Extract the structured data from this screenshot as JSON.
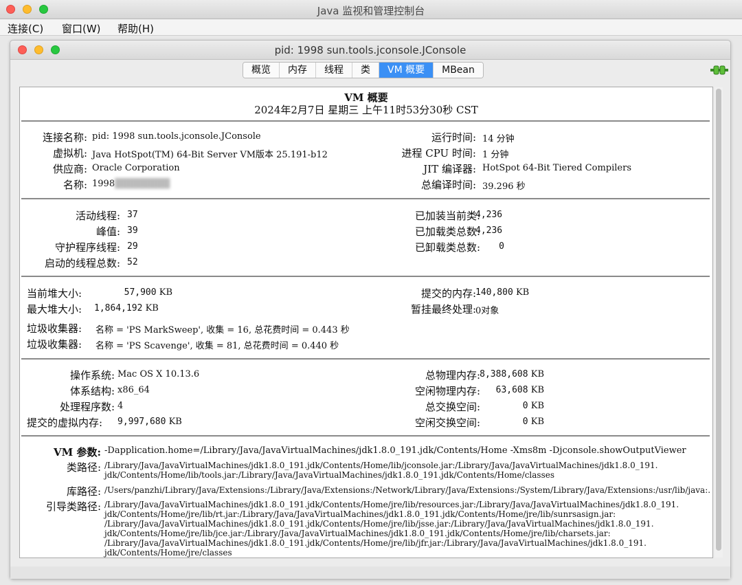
{
  "window": {
    "title": "Java 监视和管理控制台",
    "menus": [
      "连接(C)",
      "窗口(W)",
      "帮助(H)"
    ]
  },
  "inner_window": {
    "title": "pid: 1998 sun.tools.jconsole.JConsole"
  },
  "tabs": [
    "概览",
    "内存",
    "线程",
    "类",
    "VM 概要",
    "MBean"
  ],
  "active_tab": "VM 概要",
  "summary": {
    "title": "VM 概要",
    "datetime": "2024年2月7日 星期三 上午11时53分30秒 CST"
  },
  "vm_info": {
    "conn_label": "连接名称:",
    "conn_value": "pid: 1998 sun.tools.jconsole.JConsole",
    "vm_label": "虚拟机:",
    "vm_value": "Java HotSpot(TM) 64-Bit Server VM版本 25.191-b12",
    "vendor_label": "供应商:",
    "vendor_value": "Oracle Corporation",
    "name_label": "名称:",
    "name_value": "1998",
    "uptime_label": "运行时间:",
    "uptime_value": "14 分钟",
    "cpu_label": "进程 CPU 时间:",
    "cpu_value": "1 分钟",
    "jit_label": "JIT 编译器:",
    "jit_value": "HotSpot 64-Bit Tiered Compilers",
    "compile_label": "总编译时间:",
    "compile_value": "39.296 秒"
  },
  "threads": {
    "live_label": "活动线程:",
    "live_value": "37",
    "peak_label": "峰值:",
    "peak_value": "39",
    "daemon_label": "守护程序线程:",
    "daemon_value": "29",
    "started_label": "启动的线程总数:",
    "started_value": "52",
    "loaded_label": "已加装当前类:",
    "loaded_value": "4,236",
    "total_loaded_label": "已加载类总数:",
    "total_loaded_value": "4,236",
    "unloaded_label": "已卸载类总数:",
    "unloaded_value": "0"
  },
  "memory": {
    "heap_label": "当前堆大小:",
    "heap_value": "57,900",
    "heap_unit": "KB",
    "max_heap_label": "最大堆大小:",
    "max_heap_value": "1,864,192",
    "max_heap_unit": "KB",
    "committed_label": "提交的内存:",
    "committed_value": "140,800",
    "committed_unit": "KB",
    "pending_label": "暂挂最终处理:",
    "pending_value": "0对象",
    "gc1_label": "垃圾收集器:",
    "gc1_value": "名称 = 'PS MarkSweep', 收集 = 16, 总花费时间 = 0.443 秒",
    "gc2_label": "垃圾收集器:",
    "gc2_value": "名称 = 'PS Scavenge', 收集 = 81, 总花费时间 = 0.440 秒"
  },
  "os": {
    "os_label": "操作系统:",
    "os_value": "Mac OS X 10.13.6",
    "arch_label": "体系结构:",
    "arch_value": "x86_64",
    "cpus_label": "处理程序数:",
    "cpus_value": "4",
    "vmem_label": "提交的虚拟内存:",
    "vmem_value": "9,997,680",
    "vmem_unit": "KB",
    "phys_label": "总物理内存:",
    "phys_value": "8,388,608",
    "phys_unit": "KB",
    "free_phys_label": "空闲物理内存:",
    "free_phys_value": "63,608",
    "free_phys_unit": "KB",
    "swap_label": "总交换空间:",
    "swap_value": "0",
    "swap_unit": "KB",
    "free_swap_label": "空闲交换空间:",
    "free_swap_value": "0",
    "free_swap_unit": "KB"
  },
  "vm_args": {
    "args_label": "VM 参数:",
    "args_value": "-Dapplication.home=/Library/Java/JavaVirtualMachines/jdk1.8.0_191.jdk/Contents/Home -Xms8m -Djconsole.showOutputViewer",
    "classpath_label": "类路径:",
    "classpath_lines": [
      "/Library/Java/JavaVirtualMachines/jdk1.8.0_191.jdk/Contents/Home/lib/jconsole.jar:/Library/Java/JavaVirtualMachines/jdk1.8.0_191.",
      "jdk/Contents/Home/lib/tools.jar:/Library/Java/JavaVirtualMachines/jdk1.8.0_191.jdk/Contents/Home/classes"
    ],
    "libpath_label": "库路径:",
    "libpath_value": "/Users/panzhi/Library/Java/Extensions:/Library/Java/Extensions:/Network/Library/Java/Extensions:/System/Library/Java/Extensions:/usr/lib/java:.",
    "bootpath_label": "引导类路径:",
    "bootpath_lines": [
      "/Library/Java/JavaVirtualMachines/jdk1.8.0_191.jdk/Contents/Home/jre/lib/resources.jar:/Library/Java/JavaVirtualMachines/jdk1.8.0_191.",
      "jdk/Contents/Home/jre/lib/rt.jar:/Library/Java/JavaVirtualMachines/jdk1.8.0_191.jdk/Contents/Home/jre/lib/sunrsasign.jar:",
      "/Library/Java/JavaVirtualMachines/jdk1.8.0_191.jdk/Contents/Home/jre/lib/jsse.jar:/Library/Java/JavaVirtualMachines/jdk1.8.0_191.",
      "jdk/Contents/Home/jre/lib/jce.jar:/Library/Java/JavaVirtualMachines/jdk1.8.0_191.jdk/Contents/Home/jre/lib/charsets.jar:",
      "/Library/Java/JavaVirtualMachines/jdk1.8.0_191.jdk/Contents/Home/jre/lib/jfr.jar:/Library/Java/JavaVirtualMachines/jdk1.8.0_191.",
      "jdk/Contents/Home/jre/classes"
    ]
  }
}
